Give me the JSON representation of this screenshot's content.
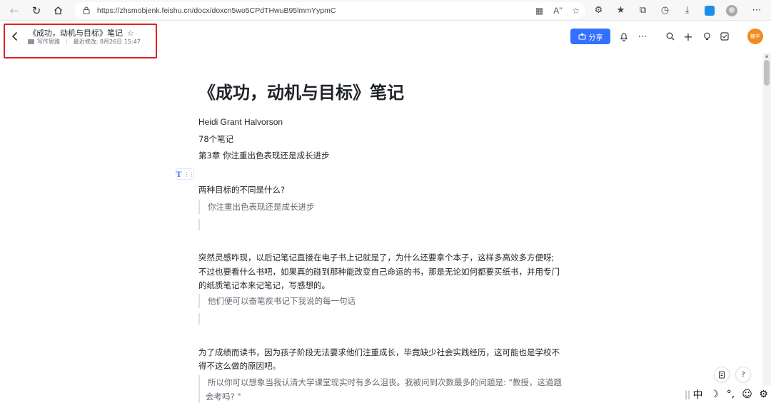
{
  "browser": {
    "url": "https://zhsmobjenk.feishu.cn/docx/doxcn5wo5CPdTHwuB95lmmYypmC",
    "icons": [
      "back-icon",
      "refresh-icon",
      "home-icon",
      "lock-icon",
      "translate-icon",
      "read-aloud-icon",
      "favorite-add-icon",
      "extension-icon",
      "favorites-icon",
      "collections-icon",
      "history-icon",
      "download-icon",
      "edge-icon",
      "profile-icon",
      "more-icon"
    ]
  },
  "header": {
    "doc_title": "《成功，动机与目标》笔记",
    "folder": "写作思路",
    "last_modified": "最近修改: 8月26日 15:47",
    "share_label": "分享",
    "avatar_label": "糖华"
  },
  "document": {
    "title": "《成功，动机与目标》笔记",
    "author": "Heidi Grant Halvorson",
    "note_count": "78个笔记",
    "chapter": "第3章 你注重出色表现还是成长进步",
    "block_handle_glyph": "T",
    "q1_heading": "两种目标的不同是什么?",
    "q1_quote": "你注重出色表现还是成长进步",
    "p2_line1": "突然灵感咋现，以后记笔记直接在电子书上记就是了，为什么还要拿个本子，这样多高效多方便呀;",
    "p2_line2": "不过也要看什么书吧，如果真的碰到那种能改变自己命运的书，那是无论如何都要买纸书，并用专门",
    "p2_line3": "的纸质笔记本来记笔记，写感想的。",
    "p2_quote": "他们便可以奋笔疾书记下我说的每一句话",
    "p3_line1": "为了成绩而读书，因为孩子阶段无法要求他们注重成长，毕竟缺少社会实践经历，这可能也是学校不",
    "p3_line2": "得不这么做的原因吧。",
    "p3_quote_line1": "所以你可以想象当我认清大学课堂现实时有多么沮丧。我被问到次数最多的问题是: \"教授，这道题",
    "p3_quote_line2": "会考吗? \""
  },
  "ime": {
    "lang": "中",
    "moon": "☽",
    "punct": "°,",
    "emoji": "☺",
    "settings": "⚙"
  },
  "colors": {
    "accent": "#3370ff",
    "highlight": "#e02020",
    "avatar": "#f08c1c"
  }
}
